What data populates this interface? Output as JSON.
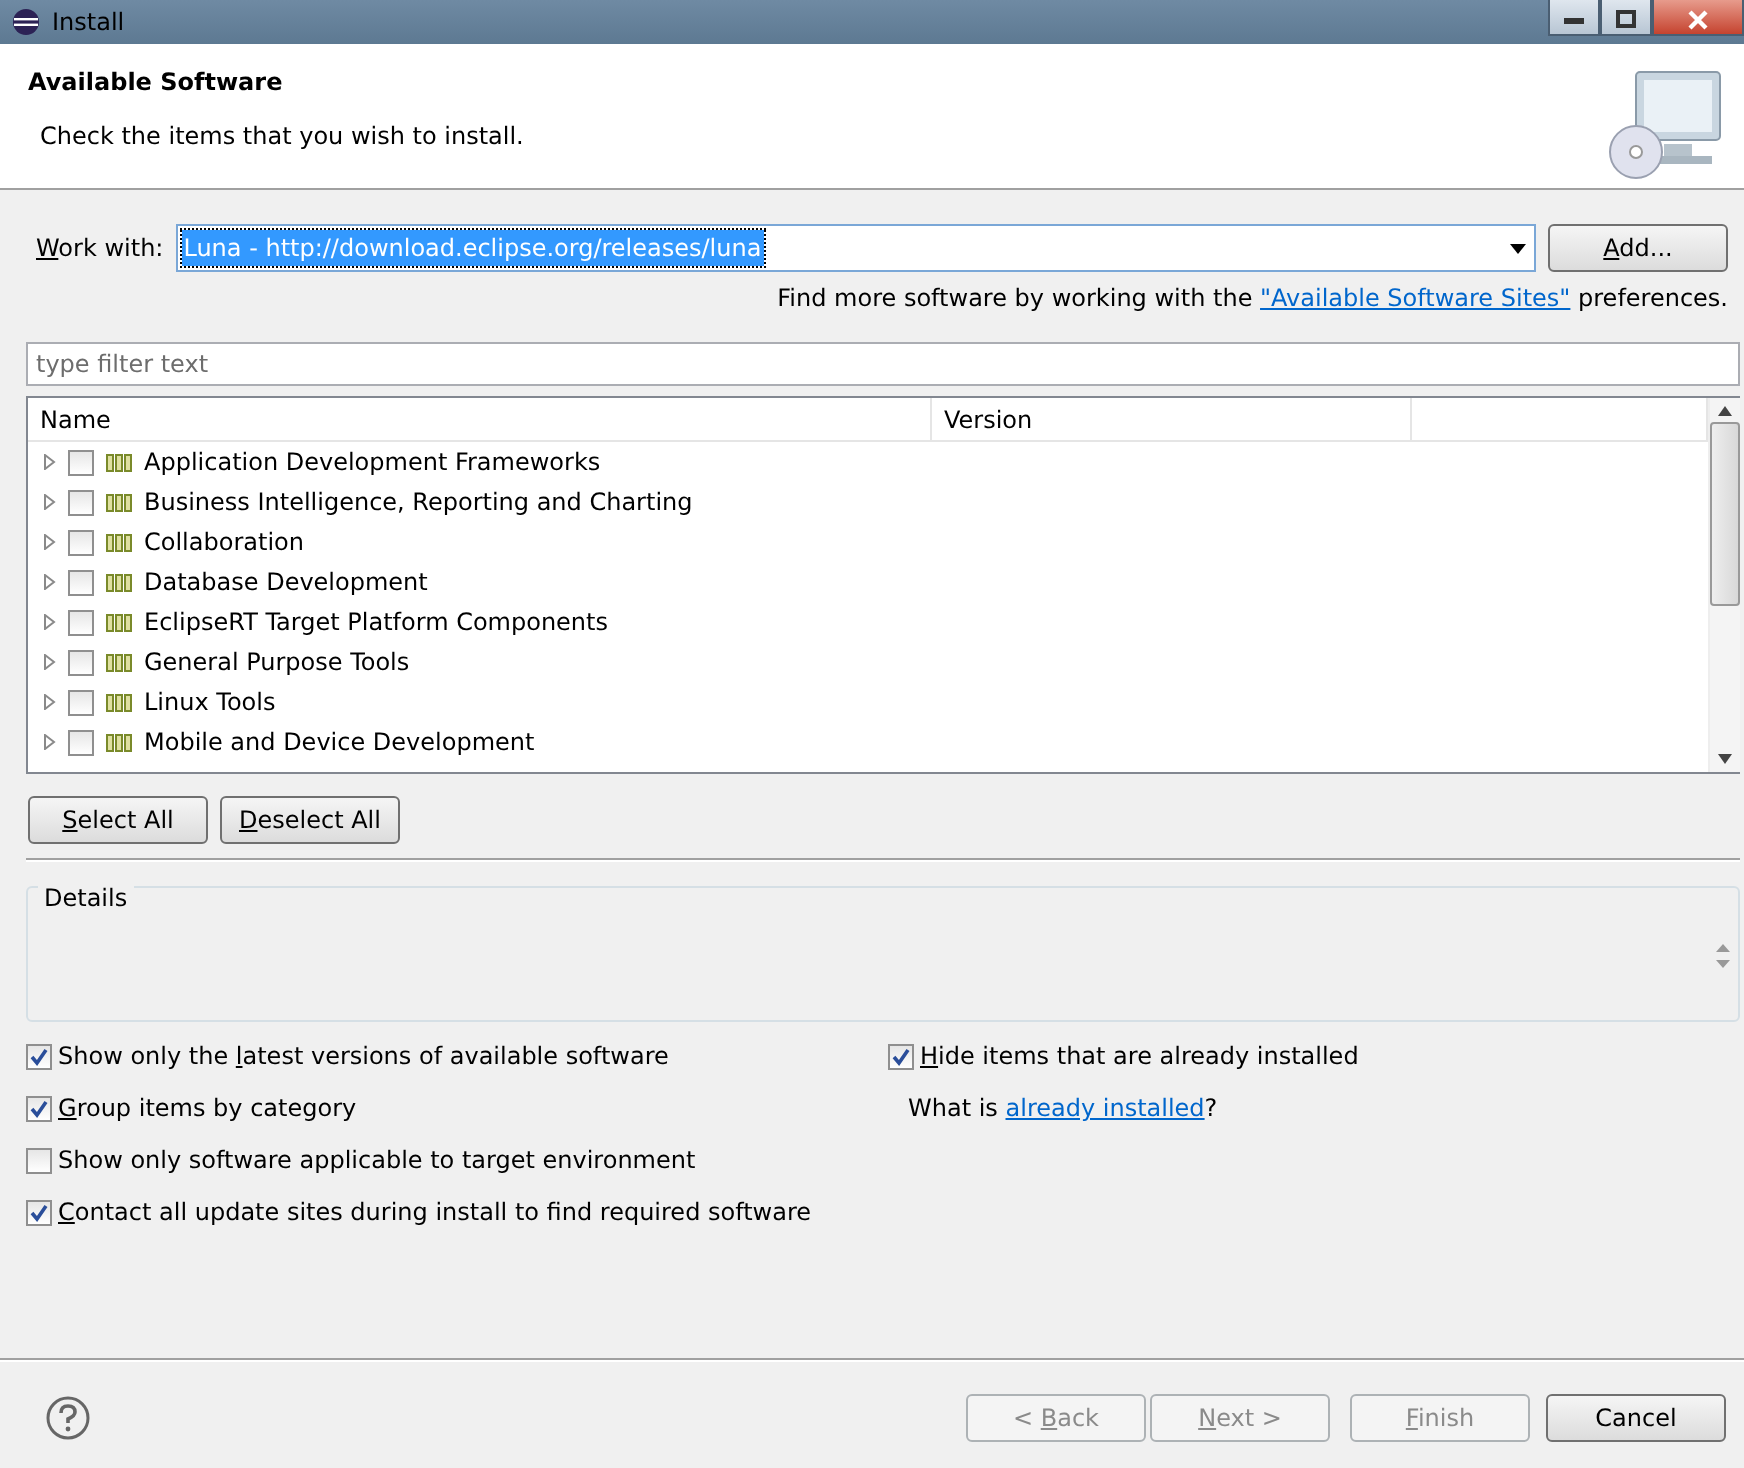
{
  "window": {
    "title": "Install"
  },
  "header": {
    "title": "Available Software",
    "subtitle": "Check the items that you wish to install."
  },
  "work_with": {
    "label": {
      "key": "W",
      "post": "ork with:"
    },
    "value": "Luna - http://download.eclipse.org/releases/luna",
    "add_button": {
      "label": {
        "key": "A",
        "post": "dd..."
      }
    }
  },
  "sites_hint": {
    "before": "Find more software by working with the ",
    "link": "\"Available Software Sites\"",
    "after": " preferences."
  },
  "filter": {
    "placeholder": "type filter text"
  },
  "tree": {
    "columns": [
      "Name",
      "Version"
    ],
    "rows": [
      {
        "name": "Application Development Frameworks",
        "checked": false,
        "expanded": false
      },
      {
        "name": "Business Intelligence, Reporting and Charting",
        "checked": false,
        "expanded": false
      },
      {
        "name": "Collaboration",
        "checked": false,
        "expanded": false
      },
      {
        "name": "Database Development",
        "checked": false,
        "expanded": false
      },
      {
        "name": "EclipseRT Target Platform Components",
        "checked": false,
        "expanded": false
      },
      {
        "name": "General Purpose Tools",
        "checked": false,
        "expanded": false
      },
      {
        "name": "Linux Tools",
        "checked": false,
        "expanded": false
      },
      {
        "name": "Mobile and Device Development",
        "checked": false,
        "expanded": false
      }
    ]
  },
  "selection_buttons": [
    {
      "label": {
        "key": "S",
        "post": "elect All"
      }
    },
    {
      "label": {
        "key": "D",
        "post": "eselect All"
      }
    }
  ],
  "details": {
    "title": "Details"
  },
  "options_left": [
    {
      "label": {
        "pre": "Show only the ",
        "key": "l",
        "post": "atest versions of available software"
      },
      "checked": true
    },
    {
      "label": {
        "key": "G",
        "post": "roup items by category"
      },
      "checked": true
    },
    {
      "label": {
        "pre": "Show only software applicable to target environment"
      },
      "checked": false
    },
    {
      "label": {
        "key": "C",
        "post": "ontact all update sites during install to find required software"
      },
      "checked": true
    }
  ],
  "options_right": {
    "hide_installed": {
      "label": {
        "key": "H",
        "post": "ide items that are already installed"
      },
      "checked": true
    },
    "what_is": {
      "before": "What is ",
      "link": "already installed",
      "after": "?"
    }
  },
  "footer_buttons": [
    {
      "label": {
        "pre": "< ",
        "key": "B",
        "post": "ack"
      },
      "disabled": true
    },
    {
      "label": {
        "key": "N",
        "post": "ext >"
      },
      "disabled": true
    },
    {
      "label": {
        "key": "F",
        "post": "inish"
      },
      "disabled": true
    },
    {
      "label": {
        "pre": "Cancel"
      },
      "disabled": false
    }
  ]
}
